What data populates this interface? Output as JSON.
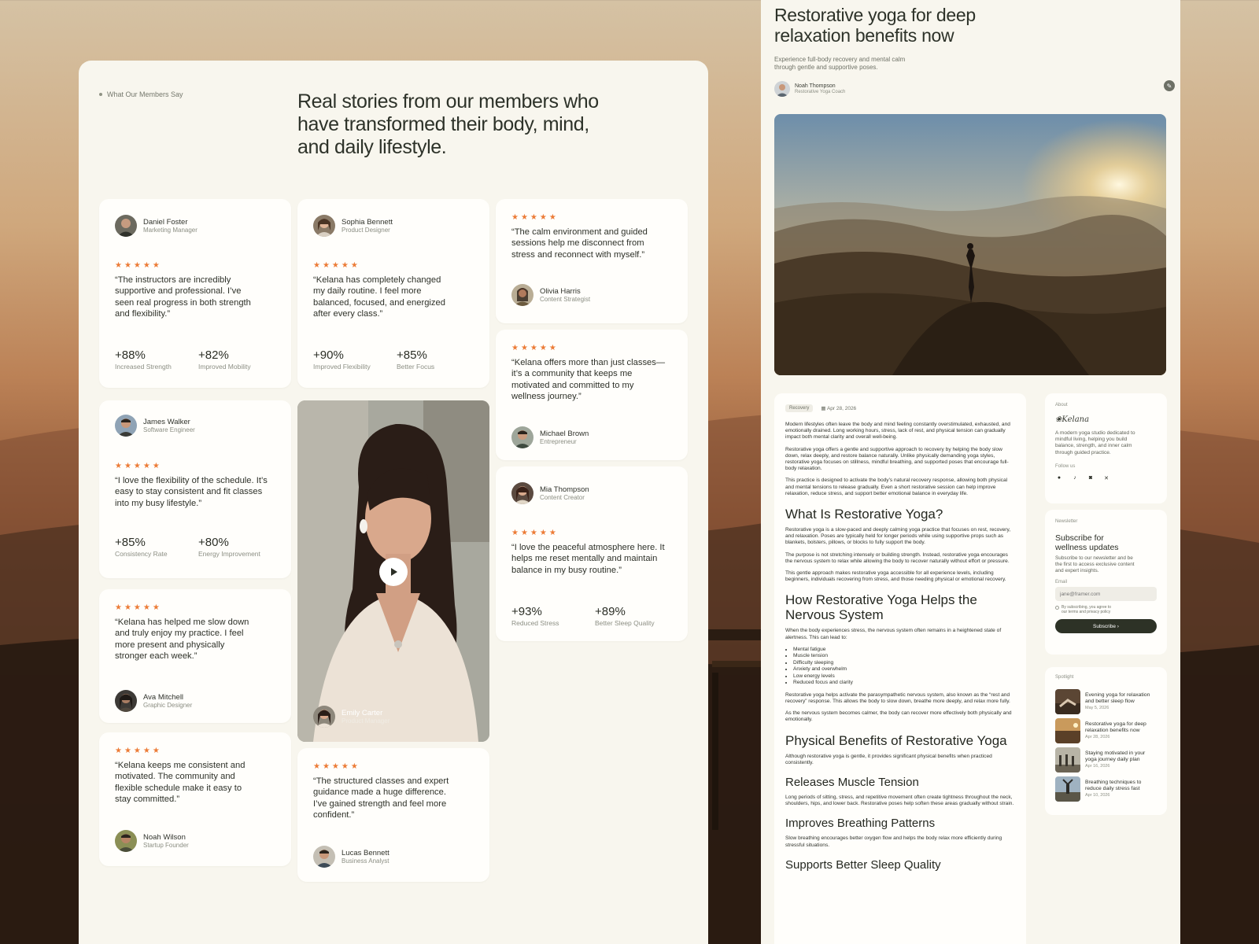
{
  "colors": {
    "accent": "#ec7b36",
    "dark_button": "#2d3226",
    "panel_bg": "#f8f6ee",
    "card_bg": "#fffefb"
  },
  "testimonials_page": {
    "eyebrow": "What Our Members Say",
    "headline": "Real stories from our members who have transformed their body, mind, and daily lifestyle.",
    "rating_stars": "★★★★★",
    "cards": [
      {
        "name": "Daniel Foster",
        "role": "Marketing Manager",
        "quote": "“The instructors are incredibly supportive and professional. I’ve seen real progress in both strength and flexibility.”",
        "stats": [
          {
            "value": "+88%",
            "label": "Increased Strength"
          },
          {
            "value": "+82%",
            "label": "Improved Mobility"
          }
        ]
      },
      {
        "name": "Sophia Bennett",
        "role": "Product Designer",
        "quote": "“Kelana has completely changed my daily routine. I feel more balanced, focused, and energized after every class.”",
        "stats": [
          {
            "value": "+90%",
            "label": "Improved Flexibility"
          },
          {
            "value": "+85%",
            "label": "Better Focus"
          }
        ]
      },
      {
        "name": "Olivia Harris",
        "role": "Content Strategist",
        "quote": "“The calm environment and guided sessions help me disconnect from stress and reconnect with myself.”"
      },
      {
        "name": "James Walker",
        "role": "Software Engineer",
        "quote": "“I love the flexibility of the schedule. It’s easy to stay consistent and fit classes into my busy lifestyle.”",
        "stats": [
          {
            "value": "+85%",
            "label": "Consistency Rate"
          },
          {
            "value": "+80%",
            "label": "Energy Improvement"
          }
        ]
      },
      {
        "name": "Michael Brown",
        "role": "Entrepreneur",
        "quote": "“Kelana offers more than just classes—it’s a community that keeps me motivated and committed to my wellness journey.”"
      },
      {
        "name": "Mia Thompson",
        "role": "Content Creator",
        "quote": "“I love the peaceful atmosphere here. It helps me reset mentally and maintain balance in my busy routine.”",
        "stats": [
          {
            "value": "+93%",
            "label": "Reduced Stress"
          },
          {
            "value": "+89%",
            "label": "Better Sleep Quality"
          }
        ]
      },
      {
        "name": "Ava Mitchell",
        "role": "Graphic Designer",
        "quote": "“Kelana has helped me slow down and truly enjoy my practice. I feel more present and physically stronger each week.”"
      },
      {
        "name": "Noah Wilson",
        "role": "Startup Founder",
        "quote": "“Kelana keeps me consistent and motivated. The community and flexible schedule make it easy to stay committed.”"
      },
      {
        "name": "Lucas Bennett",
        "role": "Business Analyst",
        "quote": "“The structured classes and expert guidance made a huge difference. I’ve gained strength and feel more confident.”"
      }
    ],
    "video": {
      "name": "Emily Carter",
      "role": "Product Manager"
    }
  },
  "blog_page": {
    "title": "Restorative yoga for deep relaxation benefits now",
    "subtitle": "Experience full-body recovery and mental calm through gentle and supportive poses.",
    "author": {
      "name": "Noah Thompson",
      "role": "Restorative Yoga Coach"
    },
    "article": {
      "tag": "Recovery",
      "date": "Apr 28, 2026",
      "intro": [
        "Modern lifestyles often leave the body and mind feeling constantly overstimulated, exhausted, and emotionally drained. Long working hours, stress, lack of rest, and physical tension can gradually impact both mental clarity and overall well-being.",
        "Restorative yoga offers a gentle and supportive approach to recovery by helping the body slow down, relax deeply, and restore balance naturally. Unlike physically demanding yoga styles, restorative yoga focuses on stillness, mindful breathing, and supported poses that encourage full-body relaxation.",
        "This practice is designed to activate the body’s natural recovery response, allowing both physical and mental tensions to release gradually. Even a short restorative session can help improve relaxation, reduce stress, and support better emotional balance in everyday life."
      ],
      "h_what": "What Is Restorative Yoga?",
      "what": [
        "Restorative yoga is a slow-paced and deeply calming yoga practice that focuses on rest, recovery, and relaxation. Poses are typically held for longer periods while using supportive props such as blankets, bolsters, pillows, or blocks to fully support the body.",
        "The purpose is not stretching intensely or building strength. Instead, restorative yoga encourages the nervous system to relax while allowing the body to recover naturally without effort or pressure.",
        "This gentle approach makes restorative yoga accessible for all experience levels, including beginners, individuals recovering from stress, and those needing physical or emotional recovery."
      ],
      "h_how": "How Restorative Yoga Helps the Nervous System",
      "how_intro": "When the body experiences stress, the nervous system often remains in a heightened state of alertness. This can lead to:",
      "how_list": [
        "Mental fatigue",
        "Muscle tension",
        "Difficulty sleeping",
        "Anxiety and overwhelm",
        "Low energy levels",
        "Reduced focus and clarity"
      ],
      "how_after": [
        "Restorative yoga helps activate the parasympathetic nervous system, also known as the “rest and recovery” response. This allows the body to slow down, breathe more deeply, and relax more fully.",
        "As the nervous system becomes calmer, the body can recover more effectively both physically and emotionally."
      ],
      "h_phys": "Physical Benefits of Restorative Yoga",
      "phys": "Although restorative yoga is gentle, it provides significant physical benefits when practiced consistently.",
      "h_muscle": "Releases Muscle Tension",
      "muscle": "Long periods of sitting, stress, and repetitive movement often create tightness throughout the neck, shoulders, hips, and lower back. Restorative poses help soften these areas gradually without strain.",
      "h_breath": "Improves Breathing Patterns",
      "breath": "Slow breathing encourages better oxygen flow and helps the body relax more efficiently during stressful situations.",
      "h_sleep": "Supports Better Sleep Quality"
    },
    "sidebar": {
      "about_label": "About",
      "brand": "Kelana",
      "about_text": "A modern yoga studio dedicated to mindful living, helping you build balance, strength, and inner calm through guided practice.",
      "follow_label": "Follow us",
      "newsletter_label": "Newsletter",
      "newsletter_title": "Subscribe for wellness updates",
      "newsletter_text": "Subscribe to our newsletter and be the first to access exclusive content and expert insights.",
      "email_label": "Email",
      "email_placeholder": "jane@framer.com",
      "consent": "By subscribing, you agree to our terms and privacy policy",
      "subscribe": "Subscribe",
      "spotlight_label": "Spotlight",
      "spotlight": [
        {
          "title": "Evening yoga for relaxation and better sleep flow",
          "date": "May 5, 2026"
        },
        {
          "title": "Restorative yoga for deep relaxation benefits now",
          "date": "Apr 28, 2026"
        },
        {
          "title": "Staying motivated in your yoga journey daily plan",
          "date": "Apr 16, 2026"
        },
        {
          "title": "Breathing techniques to reduce daily stress fast",
          "date": "Apr 10, 2026"
        }
      ]
    }
  }
}
